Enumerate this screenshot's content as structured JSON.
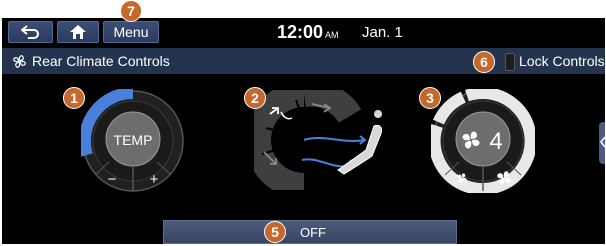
{
  "topbar": {
    "back_icon": "back-arrow-icon",
    "home_icon": "home-icon",
    "menu_label": "Menu",
    "time": "12:00",
    "ampm": "AM",
    "date": "Jan. 1"
  },
  "titlebar": {
    "icon": "fan-icon",
    "title": "Rear Climate Controls",
    "lock_label": "Lock Controls"
  },
  "temp_knob": {
    "label": "TEMP",
    "minus": "−",
    "plus": "+"
  },
  "airflow_knob": {
    "icons": [
      "vent-face-icon",
      "vent-top-icon",
      "vent-floor-icon",
      "seat-airflow-icon"
    ]
  },
  "fan_knob": {
    "icon": "fan-icon",
    "level": "4",
    "low_icon": "fan-low-icon",
    "high_icon": "fan-high-icon"
  },
  "off_button": {
    "label": "OFF"
  },
  "callouts": [
    "1",
    "2",
    "3",
    "5",
    "6",
    "7"
  ],
  "colors": {
    "accent_blue": "#4a7fdc",
    "badge_orange": "#c4682b",
    "title_bar": "#24344f"
  }
}
